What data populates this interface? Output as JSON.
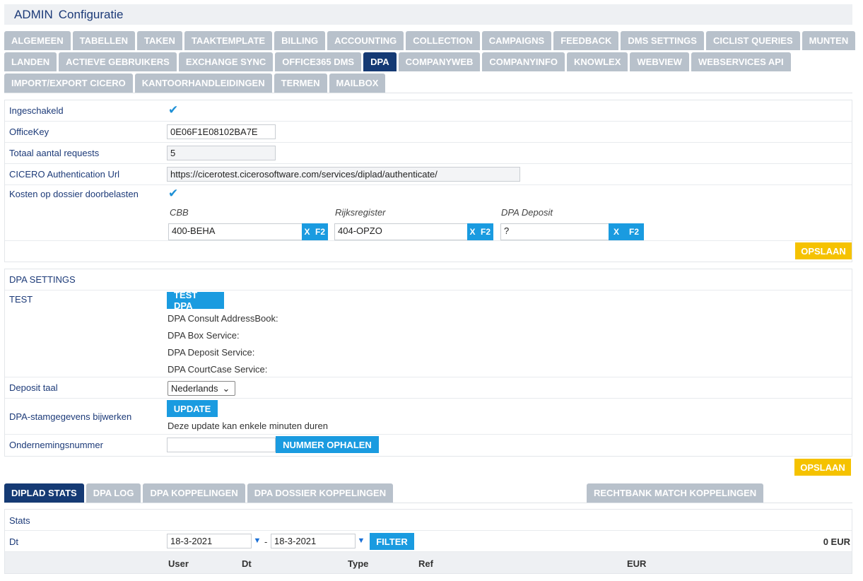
{
  "title": {
    "prefix": "ADMIN",
    "name": "Configuratie"
  },
  "tabs_row1": [
    "ALGEMEEN",
    "TABELLEN",
    "TAKEN",
    "TAAKTEMPLATE",
    "BILLING",
    "ACCOUNTING",
    "COLLECTION",
    "CAMPAIGNS",
    "FEEDBACK",
    "DMS SETTINGS",
    "CICLIST QUERIES",
    "MUNTEN"
  ],
  "tabs_row2": [
    "LANDEN",
    "ACTIEVE GEBRUIKERS",
    "EXCHANGE SYNC",
    "OFFICE365 DMS",
    "DPA",
    "COMPANYWEB",
    "COMPANYINFO",
    "KNOWLEX",
    "WEBVIEW",
    "WEBSERVICES API"
  ],
  "tabs_row3": [
    "IMPORT/EXPORT CICERO",
    "KANTOORHANDLEIDINGEN",
    "TERMEN",
    "MAILBOX"
  ],
  "config": {
    "ingeschakeld_label": "Ingeschakeld",
    "officekey_label": "OfficeKey",
    "officekey_value": "0E06F1E08102BA7E",
    "requests_label": "Totaal aantal requests",
    "requests_value": "5",
    "authurl_label": "CICERO Authentication Url",
    "authurl_value": "https://cicerotest.cicerosoftware.com/services/diplad/authenticate/",
    "kosten_label": "Kosten op dossier doorbelasten",
    "cbb_label": "CBB",
    "cbb_value": "400-BEHA",
    "rijks_label": "Rijksregister",
    "rijks_value": "404-OPZO",
    "deposit_label": "DPA Deposit",
    "deposit_value": "?",
    "x_label": "X",
    "f2_label": "F2",
    "save_label": "OPSLAAN"
  },
  "dpa": {
    "header": "DPA SETTINGS",
    "test_label": "TEST",
    "test_button": "TEST DPA",
    "services": [
      "DPA Consult AddressBook:",
      "DPA Box Service:",
      "DPA Deposit Service:",
      "DPA CourtCase Service:"
    ],
    "taal_label": "Deposit taal",
    "taal_value": "Nederlands",
    "stam_label": "DPA-stamgegevens bijwerken",
    "update_button": "UPDATE",
    "update_note": "Deze update kan enkele minuten duren",
    "onderneming_label": "Ondernemingsnummer",
    "onderneming_value": "",
    "nummer_button": "NUMMER OPHALEN",
    "save_label": "OPSLAAN"
  },
  "subtabs": [
    "DIPLAD STATS",
    "DPA LOG",
    "DPA KOPPELINGEN",
    "DPA DOSSIER KOPPELINGEN"
  ],
  "subtab_right": "RECHTBANK MATCH KOPPELINGEN",
  "stats": {
    "header": "Stats",
    "dt_label": "Dt",
    "date_from": "18-3-2021",
    "date_sep": "-",
    "date_to": "18-3-2021",
    "filter_button": "FILTER",
    "total": "0 EUR",
    "columns": [
      "User",
      "Dt",
      "Type",
      "Ref",
      "EUR"
    ]
  }
}
